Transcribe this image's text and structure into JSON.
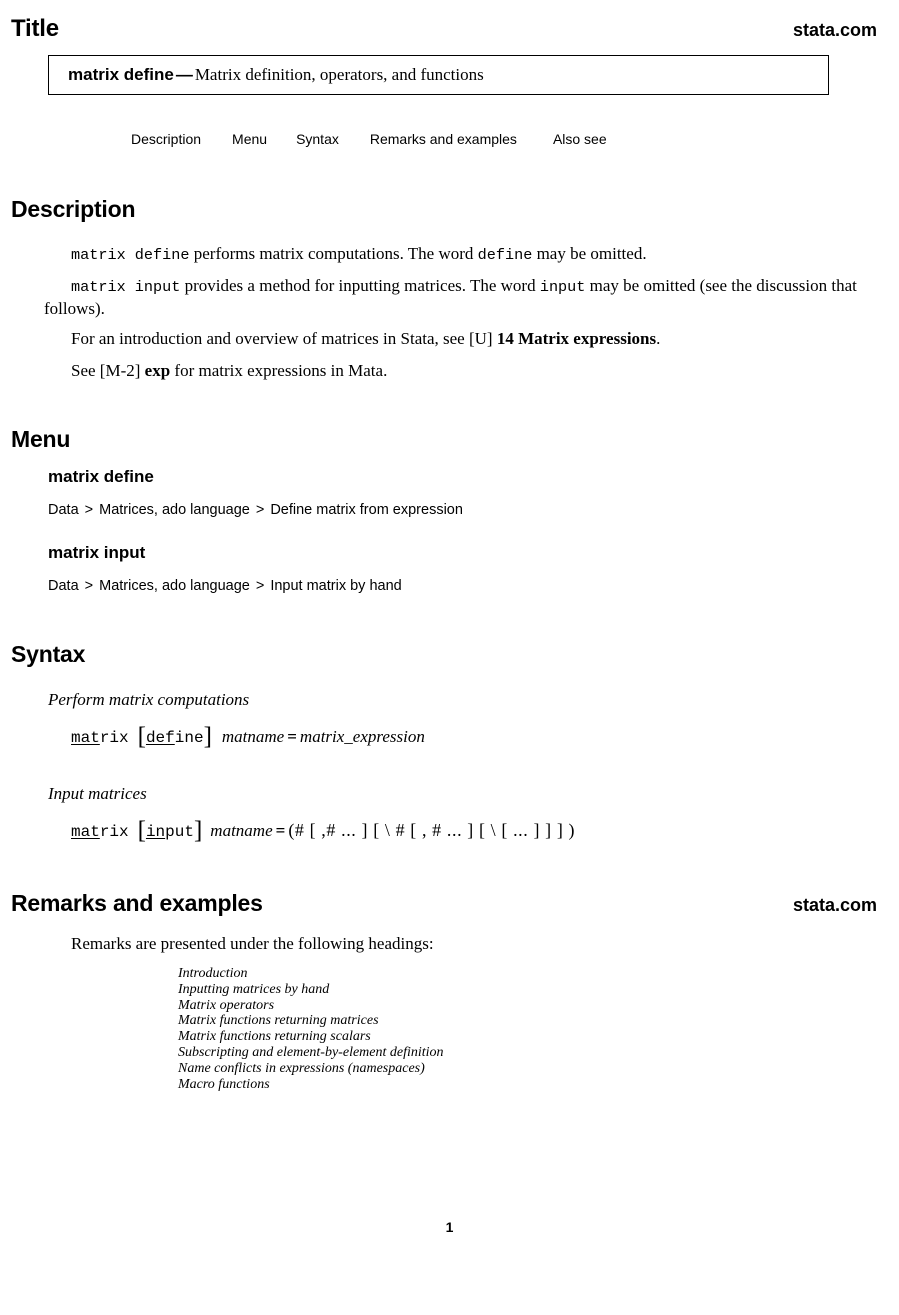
{
  "header": {
    "title": "Title",
    "stata_link": "stata.com"
  },
  "title_box": {
    "command": "matrix define",
    "dash": "—",
    "description": "Matrix definition, operators, and functions"
  },
  "nav_links": [
    {
      "label": "Description"
    },
    {
      "label": "Menu"
    },
    {
      "label": "Syntax"
    },
    {
      "label": "Remarks and examples"
    },
    {
      "label": "Also see"
    }
  ],
  "description": {
    "heading": "Description",
    "p1": {
      "code1": "matrix define",
      "text1": " performs matrix computations. The word ",
      "code2": "define",
      "text2": " may be omitted."
    },
    "p2": {
      "code1": "matrix input",
      "text1": " provides a method for inputting matrices. The word ",
      "code2": "input",
      "text2": " may be omitted (see the discussion that follows)."
    },
    "p3": {
      "text1": "For an introduction and overview of matrices in Stata, see [U] ",
      "ref": "14 Matrix expressions",
      "text2": "."
    },
    "p4": {
      "text1": "See [M-2] ",
      "ref": "exp",
      "text2": " for matrix expressions in Mata."
    }
  },
  "menu": {
    "heading": "Menu",
    "entries": [
      {
        "command": "matrix define",
        "path": [
          "Data",
          "Matrices, ado language",
          "Define matrix from expression"
        ],
        "separator": ">"
      },
      {
        "command": "matrix input",
        "path": [
          "Data",
          "Matrices, ado language",
          "Input matrix by hand"
        ],
        "separator": ">"
      }
    ]
  },
  "syntax": {
    "heading": "Syntax",
    "block1": {
      "label": "Perform matrix computations",
      "cmd_underlined": "mat",
      "cmd_rest": "rix",
      "opt_open": "[",
      "opt_underlined": "def",
      "opt_rest": "ine",
      "opt_close": "]",
      "arg1": "matname",
      "equals": "=",
      "arg2": "matrix_expression"
    },
    "block2": {
      "label": "Input matrices",
      "cmd_underlined": "mat",
      "cmd_rest": "rix",
      "opt_open": "[",
      "opt_underlined": "in",
      "opt_rest": "put",
      "opt_close": "]",
      "arg1": "matname",
      "equals": "=",
      "spec": "(# [ ,# ... ] [ \\ # [ , # ... ] [ \\ [ ... ] ] ] )"
    }
  },
  "remarks": {
    "heading": "Remarks and examples",
    "stata_link": "stata.com",
    "intro": "Remarks are presented under the following headings:",
    "toc": [
      "Introduction",
      "Inputting matrices by hand",
      "Matrix operators",
      "Matrix functions returning matrices",
      "Matrix functions returning scalars",
      "Subscripting and element-by-element definition",
      "Name conflicts in expressions (namespaces)",
      "Macro functions"
    ]
  },
  "footer": {
    "page_number": "1"
  }
}
